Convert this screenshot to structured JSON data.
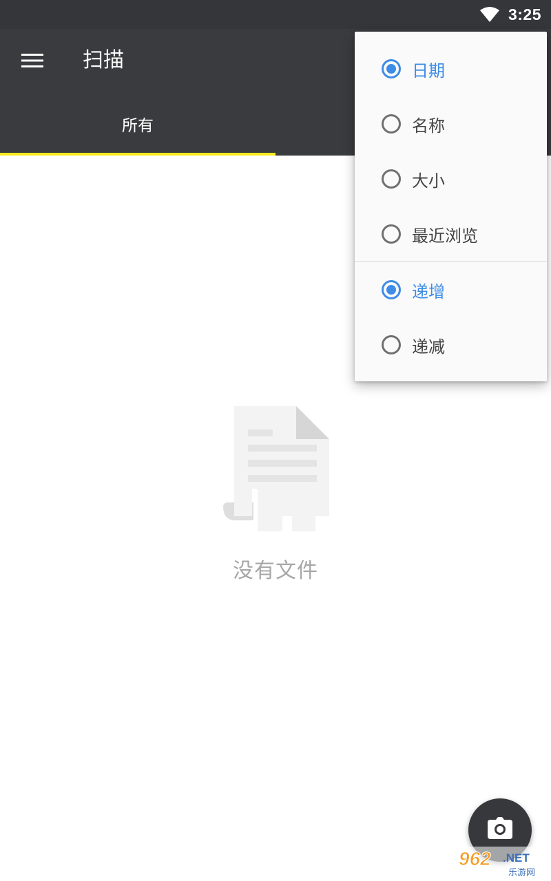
{
  "status_bar": {
    "time": "3:25",
    "wifi_icon": "wifi-icon"
  },
  "app_bar": {
    "menu_icon": "hamburger-menu-icon",
    "title": "扫描"
  },
  "tabs": [
    {
      "label": "所有",
      "active": true
    }
  ],
  "sort_menu": {
    "sort_by": [
      {
        "label": "日期",
        "checked": true
      },
      {
        "label": "名称",
        "checked": false
      },
      {
        "label": "大小",
        "checked": false
      },
      {
        "label": "最近浏览",
        "checked": false
      }
    ],
    "order": [
      {
        "label": "递增",
        "checked": true
      },
      {
        "label": "递减",
        "checked": false
      }
    ]
  },
  "empty_state": {
    "icon": "document-icon",
    "text": "没有文件"
  },
  "fab": {
    "icon": "camera-icon"
  },
  "watermark": {
    "brand_number": "962",
    "brand_suffix": ".NET",
    "brand_sub": "乐游网"
  },
  "colors": {
    "app_bar": "#3a3b3e",
    "status_bar": "#353639",
    "tab_indicator": "#f8ea1e",
    "accent": "#3d8ce8",
    "empty_text": "#a7a7a7"
  }
}
